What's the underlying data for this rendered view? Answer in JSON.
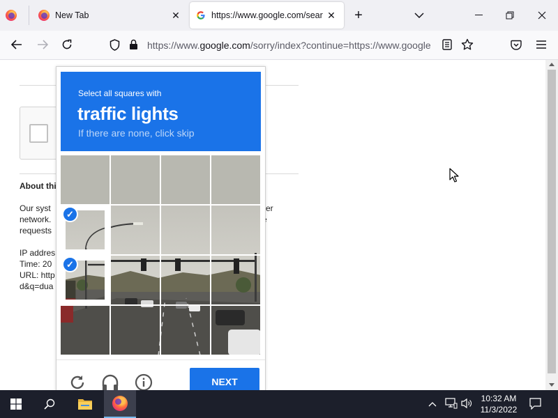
{
  "browser": {
    "tabs": [
      {
        "label": "New Tab",
        "icon": "firefox-icon"
      },
      {
        "label": "https://www.google.com/searc",
        "icon": "google-g-icon",
        "active": true
      }
    ],
    "url": {
      "prefix": "https://www.",
      "host": "google.com",
      "path": "/sorry/index?continue=https://www.google"
    }
  },
  "background_page": {
    "heading": "About thi",
    "lines": [
      "Our syst",
      "network.",
      "requests",
      "",
      "IP addres",
      "Time: 20",
      "URL: http",
      "d&q=dua"
    ],
    "right_fragments": [
      "er",
      "e"
    ]
  },
  "captcha": {
    "instruction_line1": "Select all squares with",
    "target": "traffic lights",
    "instruction_line3": "If there are none, click skip",
    "selected_tiles": [
      4,
      8
    ],
    "next_label": "NEXT",
    "accent_color": "#1a73e8"
  },
  "taskbar": {
    "time": "10:32 AM",
    "date": "11/3/2022"
  }
}
